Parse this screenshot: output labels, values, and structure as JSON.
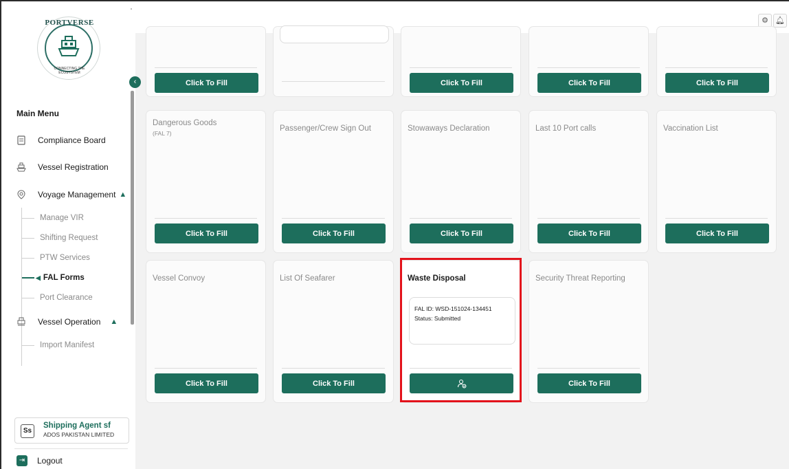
{
  "brand": {
    "name": "PORTVERSE",
    "tagline": "CONNECTING THE ECOSYSTEM"
  },
  "sidebar": {
    "menu_title": "Main Menu",
    "items": [
      {
        "label": "Compliance Board",
        "icon": "clipboard-icon"
      },
      {
        "label": "Vessel Registration",
        "icon": "ship-icon"
      },
      {
        "label": "Voyage Management",
        "icon": "location-pin-icon",
        "chevron": "^"
      },
      {
        "label": "Vessel Operation",
        "icon": "cargo-ship-icon",
        "chevron": "^"
      }
    ],
    "voyage_sub": [
      "Manage VIR",
      "Shifting Request",
      "PTW Services",
      "FAL Forms",
      "Port Clearance"
    ],
    "operation_sub": [
      "Import Manifest"
    ],
    "active_item": "FAL Forms",
    "agent": {
      "initials": "Ss",
      "name": "Shipping Agent sf",
      "org": "ADOS PAKISTAN LIMITED"
    },
    "logout_label": "Logout"
  },
  "topbar": {
    "icons": [
      "settings-icon",
      "bell-icon"
    ]
  },
  "cards_row1": [
    {
      "button": "Click To Fill"
    },
    {
      "button": ""
    },
    {
      "button": "Click To Fill"
    },
    {
      "button": "Click To Fill"
    },
    {
      "button": "Click To Fill"
    }
  ],
  "cards_row2": [
    {
      "title": "Dangerous Goods",
      "subtitle": "(FAL 7)",
      "button": "Click To Fill"
    },
    {
      "title": "Passenger/Crew Sign Out",
      "button": "Click To Fill"
    },
    {
      "title": "Stowaways Declaration",
      "button": "Click To Fill"
    },
    {
      "title": "Last 10 Port calls",
      "button": "Click To Fill"
    },
    {
      "title": "Vaccination List",
      "button": "Click To Fill"
    }
  ],
  "cards_row3": [
    {
      "title": "Vessel Convoy",
      "button": "Click To Fill"
    },
    {
      "title": "List Of Seafarer",
      "button": "Click To Fill"
    },
    {
      "title": "Waste Disposal",
      "fal_id": "FAL ID: WSD-151024-134451",
      "status": "Status: Submitted",
      "button_icon": "user-check-icon"
    },
    {
      "title": "Security Threat Reporting",
      "button": "Click To Fill"
    }
  ],
  "colors": {
    "accent": "#1d6e5c",
    "highlight": "#e3121b",
    "background": "#f2f2f2"
  }
}
